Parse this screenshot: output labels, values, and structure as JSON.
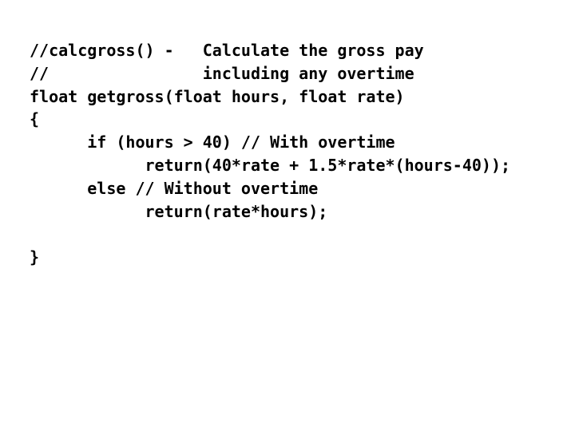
{
  "slide": {
    "background_color": "#ffffff",
    "text_color": "#000000"
  },
  "code": {
    "language": "c",
    "lines": [
      "//calcgross() -   Calculate the gross pay",
      "//                including any overtime",
      "float getgross(float hours, float rate)",
      "{",
      "      if (hours > 40) // With overtime",
      "            return(40*rate + 1.5*rate*(hours-40));",
      "      else // Without overtime",
      "            return(rate*hours);",
      "",
      "}"
    ]
  }
}
